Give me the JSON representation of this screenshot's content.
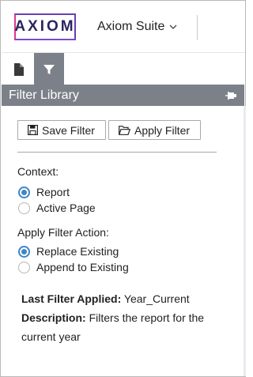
{
  "header": {
    "logo_text": "AXIOM",
    "suite_label": "Axiom Suite"
  },
  "tabs": [
    {
      "name": "document",
      "icon": "document-icon",
      "active": false
    },
    {
      "name": "filter",
      "icon": "filter-icon",
      "active": true
    }
  ],
  "panel": {
    "title": "Filter Library",
    "pin_icon": "pin-icon"
  },
  "toolbar": {
    "save_label": "Save Filter",
    "apply_label": "Apply Filter"
  },
  "context": {
    "label": "Context:",
    "options": [
      {
        "label": "Report",
        "selected": true
      },
      {
        "label": "Active Page",
        "selected": false
      }
    ]
  },
  "apply_action": {
    "label": "Apply Filter Action:",
    "options": [
      {
        "label": "Replace Existing",
        "selected": true
      },
      {
        "label": "Append to Existing",
        "selected": false
      }
    ]
  },
  "info": {
    "last_filter_label": "Last Filter Applied:",
    "last_filter_value": "Year_Current",
    "description_label": "Description:",
    "description_value": "Filters the report for the current year"
  },
  "colors": {
    "accent": "#3d86c9",
    "panel_header": "#7c8189",
    "logo_navy": "#2b2560"
  }
}
